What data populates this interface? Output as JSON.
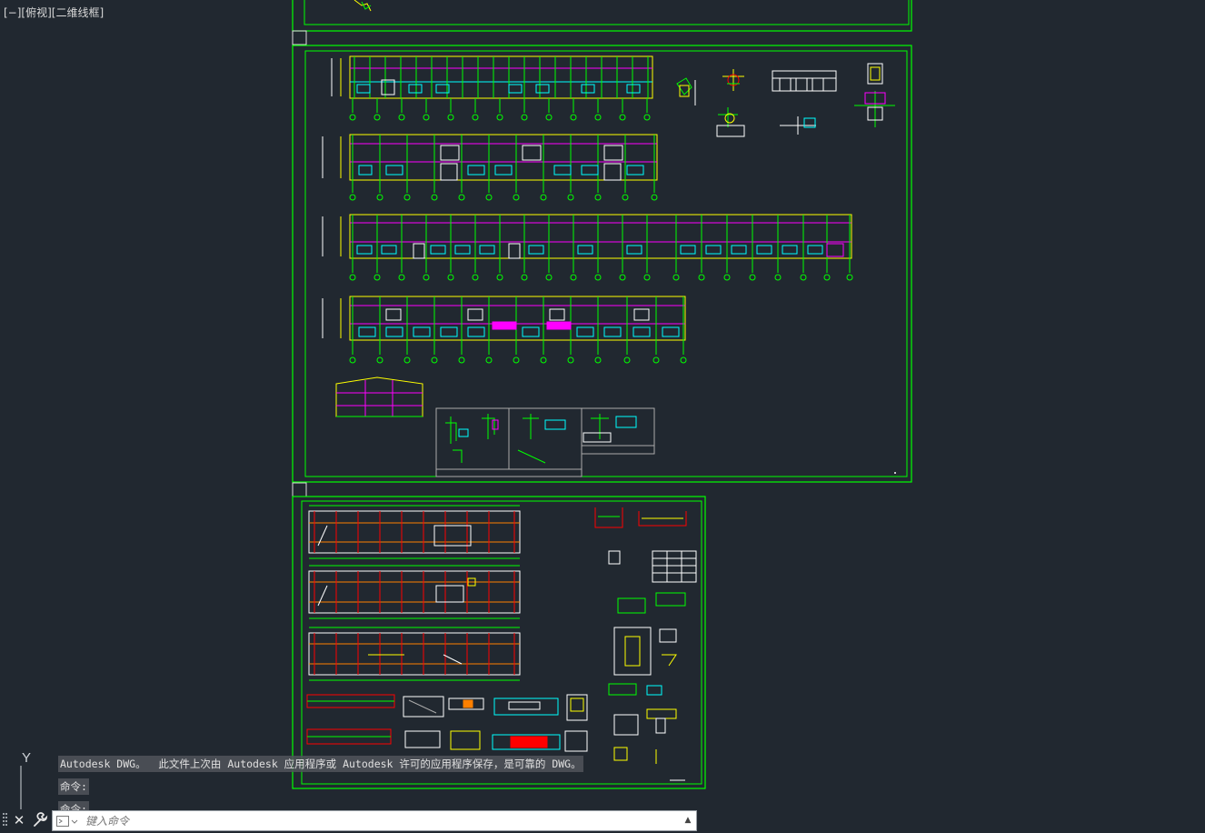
{
  "viewport": {
    "label": "[−][俯视][二维线框]"
  },
  "colors": {
    "background": "#212830",
    "frame": "#00ff00",
    "cyan": "#00ffff",
    "yellow": "#ffff00",
    "magenta": "#ff00ff",
    "red": "#ff0000",
    "white": "#ffffff",
    "orange": "#ff8000"
  },
  "ucs": {
    "y_label": "Y"
  },
  "command_history": [
    "Autodesk DWG。  此文件上次由 Autodesk 应用程序或 Autodesk 许可的应用程序保存，是可靠的 DWG。",
    "命令:",
    "命令:"
  ],
  "command_line": {
    "placeholder": "键入命令",
    "close_icon": "close-icon",
    "settings_icon": "wrench-icon",
    "prompt_icon": "command-prompt-icon",
    "recent_icon": "chevron-up-icon"
  }
}
